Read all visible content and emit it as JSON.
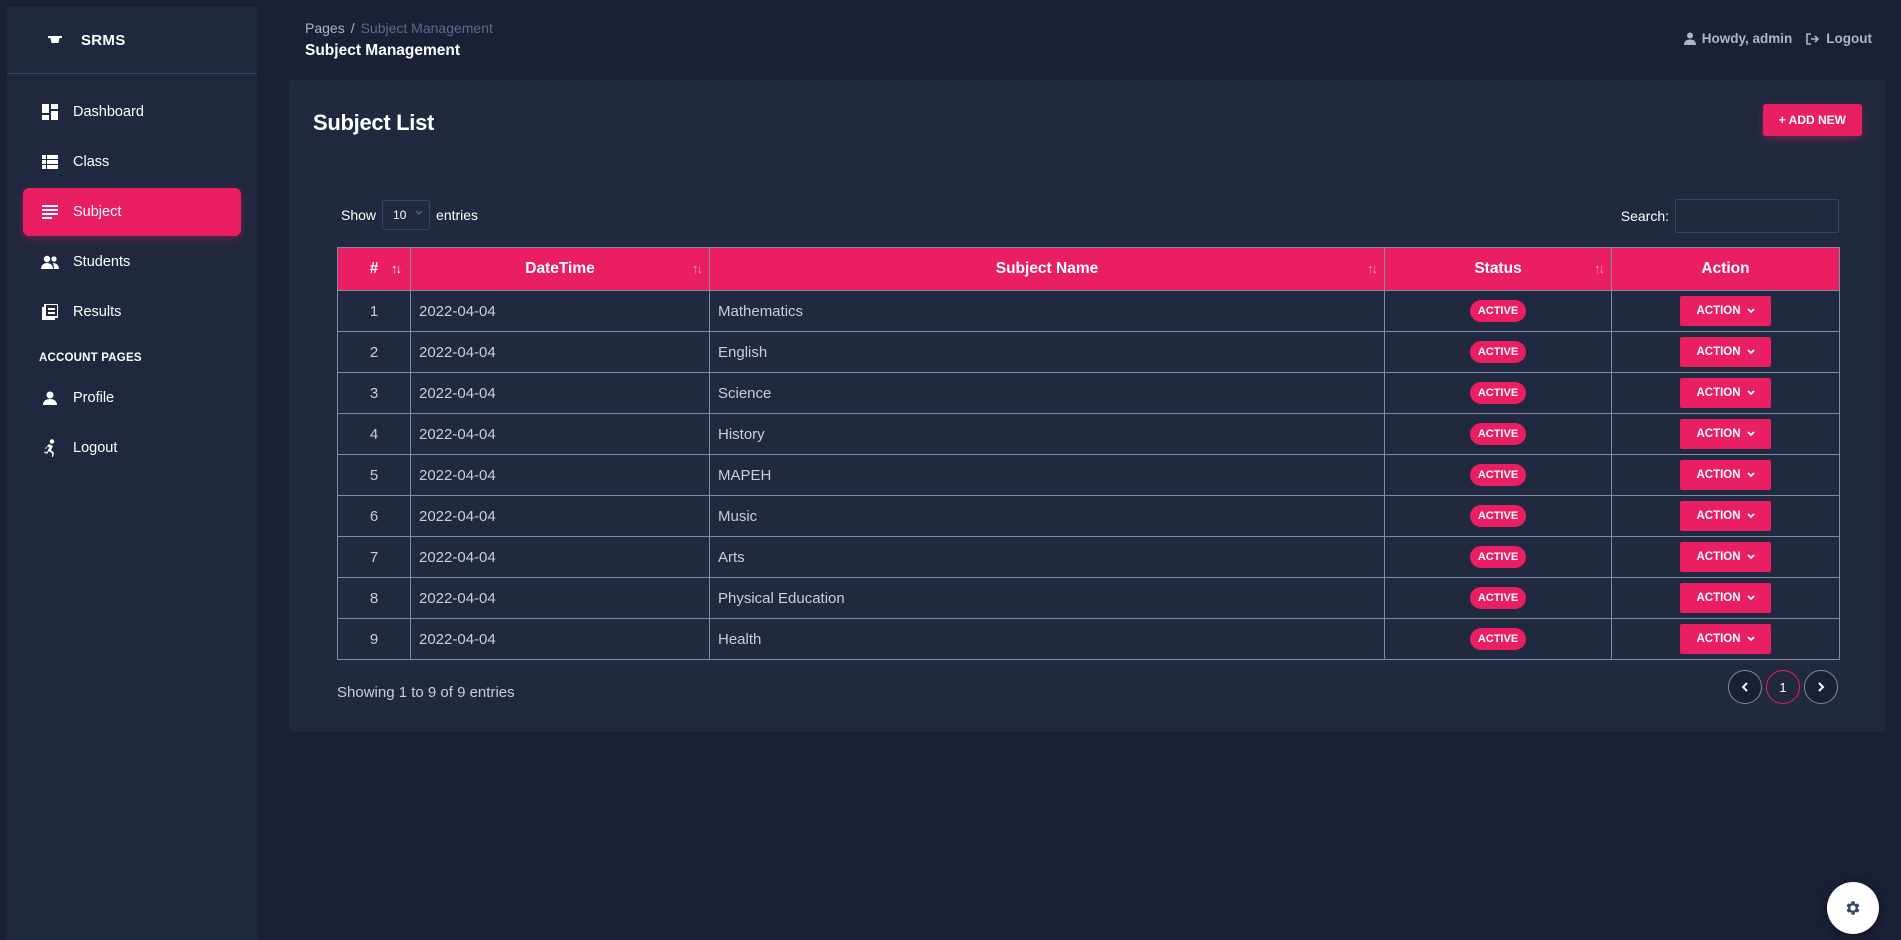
{
  "app": {
    "name": "SRMS"
  },
  "sidebar": {
    "items": [
      {
        "label": "Dashboard",
        "icon": "dashboard-icon"
      },
      {
        "label": "Class",
        "icon": "list-icon"
      },
      {
        "label": "Subject",
        "icon": "subject-icon",
        "active": true
      },
      {
        "label": "Students",
        "icon": "people-icon"
      },
      {
        "label": "Results",
        "icon": "results-icon"
      }
    ],
    "section_label": "ACCOUNT PAGES",
    "account_items": [
      {
        "label": "Profile",
        "icon": "person-icon"
      },
      {
        "label": "Logout",
        "icon": "run-icon"
      }
    ]
  },
  "header": {
    "breadcrumb_root": "Pages",
    "breadcrumb_sep": "/",
    "breadcrumb_current": "Subject Management",
    "title": "Subject Management",
    "user_greeting": "Howdy, admin",
    "logout_label": "Logout"
  },
  "card": {
    "title": "Subject List",
    "add_button": "+ ADD NEW",
    "show_label": "Show",
    "page_length": "10",
    "entries_label": "entries",
    "search_label": "Search:",
    "search_value": ""
  },
  "table": {
    "columns": [
      "#",
      "DateTime",
      "Subject Name",
      "Status",
      "Action"
    ],
    "rows": [
      {
        "no": "1",
        "datetime": "2022-04-04",
        "subject": "Mathematics",
        "status": "ACTIVE",
        "action": "ACTION"
      },
      {
        "no": "2",
        "datetime": "2022-04-04",
        "subject": "English",
        "status": "ACTIVE",
        "action": "ACTION"
      },
      {
        "no": "3",
        "datetime": "2022-04-04",
        "subject": "Science",
        "status": "ACTIVE",
        "action": "ACTION"
      },
      {
        "no": "4",
        "datetime": "2022-04-04",
        "subject": "History",
        "status": "ACTIVE",
        "action": "ACTION"
      },
      {
        "no": "5",
        "datetime": "2022-04-04",
        "subject": "MAPEH",
        "status": "ACTIVE",
        "action": "ACTION"
      },
      {
        "no": "6",
        "datetime": "2022-04-04",
        "subject": "Music",
        "status": "ACTIVE",
        "action": "ACTION"
      },
      {
        "no": "7",
        "datetime": "2022-04-04",
        "subject": "Arts",
        "status": "ACTIVE",
        "action": "ACTION"
      },
      {
        "no": "8",
        "datetime": "2022-04-04",
        "subject": "Physical Education",
        "status": "ACTIVE",
        "action": "ACTION"
      },
      {
        "no": "9",
        "datetime": "2022-04-04",
        "subject": "Health",
        "status": "ACTIVE",
        "action": "ACTION"
      }
    ]
  },
  "footer": {
    "info": "Showing 1 to 9 of 9 entries",
    "current_page": "1"
  },
  "colors": {
    "accent": "#e91e63",
    "background": "#1a2035",
    "card": "#202940",
    "sidebar": "#1f283e"
  }
}
